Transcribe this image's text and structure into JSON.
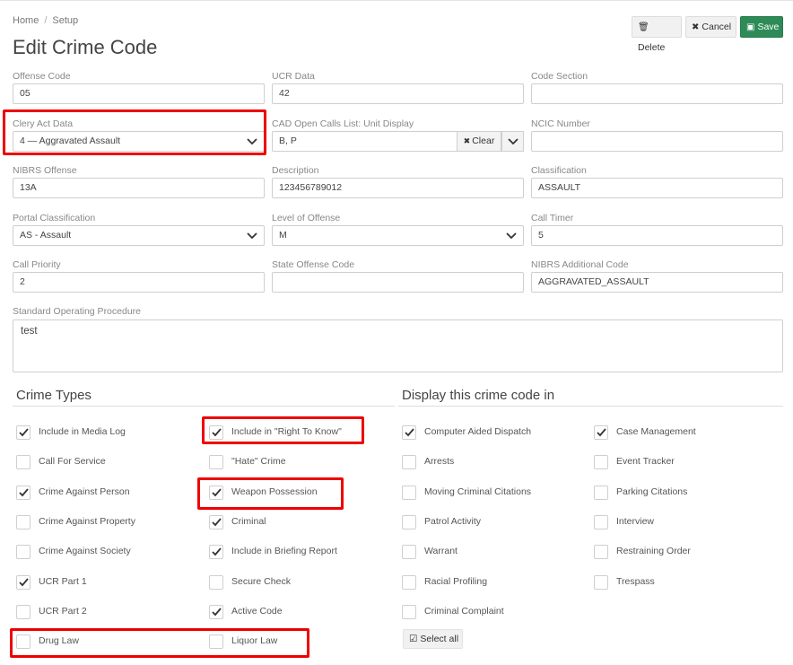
{
  "breadcrumb": {
    "home": "Home",
    "sep": "/",
    "current": "Setup"
  },
  "page_title": "Edit Crime Code",
  "toolbar": {
    "delete_label": "Delete",
    "cancel_label": "Cancel",
    "save_label": "Save"
  },
  "fields": {
    "offense_code": {
      "label": "Offense Code",
      "value": "05"
    },
    "ucr_data": {
      "label": "UCR Data",
      "value": "42"
    },
    "code_section": {
      "label": "Code Section",
      "value": ""
    },
    "clery_act": {
      "label": "Clery Act Data",
      "value": "4 — Aggravated Assault"
    },
    "cad_open": {
      "label": "CAD Open Calls List: Unit Display",
      "value": "B, P",
      "clear": "Clear"
    },
    "ncic": {
      "label": "NCIC Number",
      "value": ""
    },
    "nibrs_offense": {
      "label": "NIBRS Offense",
      "value": "13A"
    },
    "description": {
      "label": "Description",
      "value": "123456789012"
    },
    "classification": {
      "label": "Classification",
      "value": "ASSAULT"
    },
    "portal_class": {
      "label": "Portal Classification",
      "value": "AS - Assault"
    },
    "level_offense": {
      "label": "Level of Offense",
      "value": "M"
    },
    "call_timer": {
      "label": "Call Timer",
      "value": "5"
    },
    "call_priority": {
      "label": "Call Priority",
      "value": "2"
    },
    "state_offense": {
      "label": "State Offense Code",
      "value": ""
    },
    "nibrs_additional": {
      "label": "NIBRS Additional Code",
      "value": "AGGRAVATED_ASSAULT"
    },
    "sop": {
      "label": "Standard Operating Procedure",
      "value": "test"
    }
  },
  "crime_types": {
    "title": "Crime Types",
    "col1": [
      {
        "label": "Include in Media Log",
        "checked": true
      },
      {
        "label": "Call For Service",
        "checked": false
      },
      {
        "label": "Crime Against Person",
        "checked": true
      },
      {
        "label": "Crime Against Property",
        "checked": false
      },
      {
        "label": "Crime Against Society",
        "checked": false
      },
      {
        "label": "UCR Part 1",
        "checked": true
      },
      {
        "label": "UCR Part 2",
        "checked": false
      },
      {
        "label": "Drug Law",
        "checked": false
      }
    ],
    "col2": [
      {
        "label": "Include in \"Right To Know\"",
        "checked": true
      },
      {
        "label": "\"Hate\" Crime",
        "checked": false
      },
      {
        "label": "Weapon Possession",
        "checked": true
      },
      {
        "label": "Criminal",
        "checked": true
      },
      {
        "label": "Include in Briefing Report",
        "checked": true
      },
      {
        "label": "Secure Check",
        "checked": false
      },
      {
        "label": "Active Code",
        "checked": true
      },
      {
        "label": "Liquor Law",
        "checked": false
      }
    ]
  },
  "display_in": {
    "title": "Display this crime code in",
    "col1": [
      {
        "label": "Computer Aided Dispatch",
        "checked": true
      },
      {
        "label": "Arrests",
        "checked": false
      },
      {
        "label": "Moving Criminal Citations",
        "checked": false
      },
      {
        "label": "Patrol Activity",
        "checked": false
      },
      {
        "label": "Warrant",
        "checked": false
      },
      {
        "label": "Racial Profiling",
        "checked": false
      },
      {
        "label": "Criminal Complaint",
        "checked": false
      }
    ],
    "col2": [
      {
        "label": "Case Management",
        "checked": true
      },
      {
        "label": "Event Tracker",
        "checked": false
      },
      {
        "label": "Parking Citations",
        "checked": false
      },
      {
        "label": "Interview",
        "checked": false
      },
      {
        "label": "Restraining Order",
        "checked": false
      },
      {
        "label": "Trespass",
        "checked": false
      }
    ],
    "select_all": "Select all"
  },
  "colors": {
    "highlight": "#ee0000",
    "save_green": "#2e8b57"
  }
}
